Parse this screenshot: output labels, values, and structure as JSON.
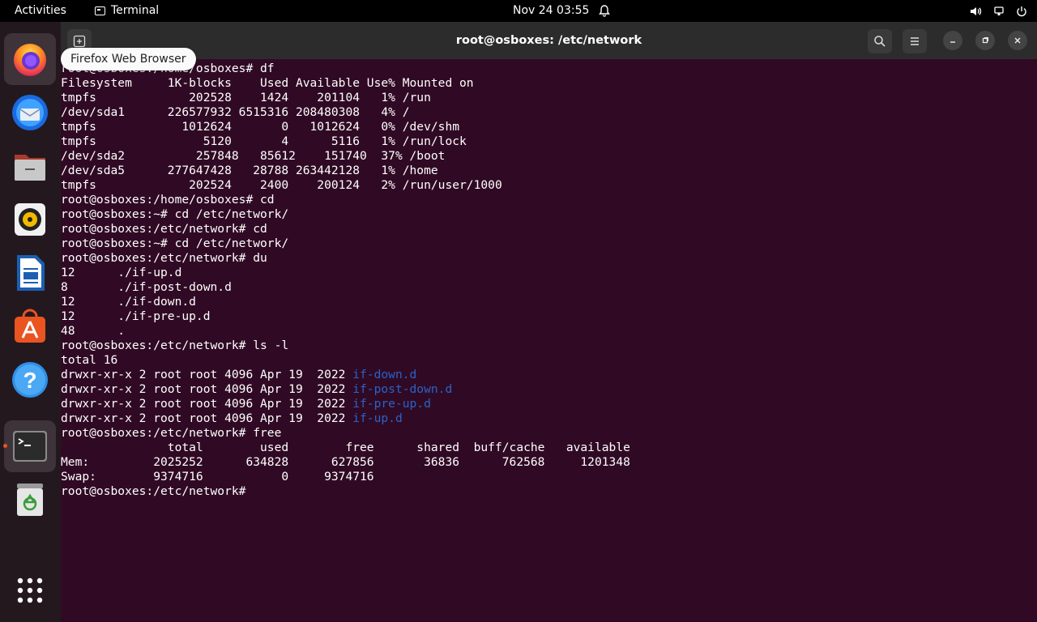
{
  "topbar": {
    "activities": "Activities",
    "app_name": "Terminal",
    "clock": "Nov 24  03:55"
  },
  "tooltip": "Firefox Web Browser",
  "dock": {
    "items": [
      "firefox-icon",
      "thunderbird-icon",
      "files-icon",
      "rhythmbox-icon",
      "libreoffice-writer-icon",
      "app-center-icon",
      "help-icon",
      "terminal-icon",
      "trash-icon",
      "show-apps-icon"
    ]
  },
  "window": {
    "title": "root@osboxes: /etc/network"
  },
  "terminal": {
    "lines": [
      {
        "t": "root@osboxes:/home/osboxes# df"
      },
      {
        "t": "Filesystem     1K-blocks    Used Available Use% Mounted on"
      },
      {
        "t": "tmpfs             202528    1424    201104   1% /run"
      },
      {
        "t": "/dev/sda1      226577932 6515316 208480308   4% /"
      },
      {
        "t": "tmpfs            1012624       0   1012624   0% /dev/shm"
      },
      {
        "t": "tmpfs               5120       4      5116   1% /run/lock"
      },
      {
        "t": "/dev/sda2          257848   85612    151740  37% /boot"
      },
      {
        "t": "/dev/sda5      277647428   28788 263442128   1% /home"
      },
      {
        "t": "tmpfs             202524    2400    200124   2% /run/user/1000"
      },
      {
        "t": "root@osboxes:/home/osboxes# cd"
      },
      {
        "t": "root@osboxes:~# cd /etc/network/"
      },
      {
        "t": "root@osboxes:/etc/network# cd"
      },
      {
        "t": "root@osboxes:~# cd /etc/network/"
      },
      {
        "t": "root@osboxes:/etc/network# du"
      },
      {
        "t": "12      ./if-up.d"
      },
      {
        "t": "8       ./if-post-down.d"
      },
      {
        "t": "12      ./if-down.d"
      },
      {
        "t": "12      ./if-pre-up.d"
      },
      {
        "t": "48      ."
      },
      {
        "t": "root@osboxes:/etc/network# ls -l"
      },
      {
        "t": "total 16"
      },
      {
        "t": "drwxr-xr-x 2 root root 4096 Apr 19  2022 ",
        "blue": "if-down.d"
      },
      {
        "t": "drwxr-xr-x 2 root root 4096 Apr 19  2022 ",
        "blue": "if-post-down.d"
      },
      {
        "t": "drwxr-xr-x 2 root root 4096 Apr 19  2022 ",
        "blue": "if-pre-up.d"
      },
      {
        "t": "drwxr-xr-x 2 root root 4096 Apr 19  2022 ",
        "blue": "if-up.d"
      },
      {
        "t": "root@osboxes:/etc/network# free"
      },
      {
        "t": "               total        used        free      shared  buff/cache   available"
      },
      {
        "t": "Mem:         2025252      634828      627856       36836      762568     1201348"
      },
      {
        "t": "Swap:        9374716           0     9374716"
      },
      {
        "t": "root@osboxes:/etc/network# "
      }
    ]
  }
}
